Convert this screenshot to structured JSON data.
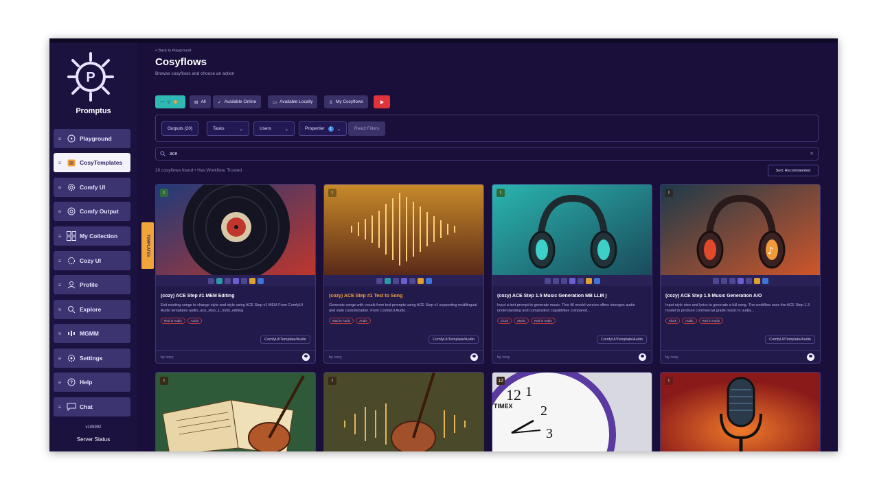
{
  "sidebar": {
    "brand": "Promptus",
    "items": [
      {
        "label": "Playground",
        "icon": "play-circle-icon"
      },
      {
        "label": "CosyTemplates",
        "icon": "template-icon"
      },
      {
        "label": "Comfy UI",
        "icon": "gear-icon"
      },
      {
        "label": "Comfy Output",
        "icon": "output-icon"
      },
      {
        "label": "My Collection",
        "icon": "grid-icon"
      },
      {
        "label": "Cozy UI",
        "icon": "cog-icon"
      },
      {
        "label": "Profile",
        "icon": "user-icon"
      },
      {
        "label": "Explore",
        "icon": "search-icon"
      },
      {
        "label": "MGMM",
        "icon": "mgmm-icon"
      },
      {
        "label": "Settings",
        "icon": "settings-icon"
      },
      {
        "label": "Help",
        "icon": "help-icon"
      },
      {
        "label": "Chat",
        "icon": "chat-icon"
      }
    ],
    "version": "v105992",
    "server_status": "Server Status",
    "side_tab": "TEMPLATES"
  },
  "header": {
    "back": "< Back to Playground",
    "title": "Cosyflows",
    "subtitle": "Browse cosyflows and choose an action"
  },
  "tabs": {
    "all": "All",
    "available_online": "Available Online",
    "available_locally": "Available Locally",
    "my_cosyflows": "My Cosyflows"
  },
  "filters": {
    "outputs": "Outputs (20)",
    "tasks": "Tasks",
    "users": "Users",
    "properties": "Propertier",
    "reset": "React Filters"
  },
  "search": {
    "value": "ace"
  },
  "results": {
    "summary": "20 cosyflows found • Has Workflow, Trusted",
    "sort": "Sort: Recommended"
  },
  "cards": [
    {
      "title": "(cozy) ACE Step #1 MEM Editing",
      "desc": "Exit existing songs to change style-and style using ACE Step v1 MEM From ComfyUI Audio templates audio_ace_step_1_m2in_editing",
      "tags": [
        "Red to Audio",
        "Audio"
      ],
      "path": "ComfyUI/Template/Audio",
      "author": "by cozy",
      "highlight": false
    },
    {
      "title": "(cozy) ACE Step #1 Test to Song",
      "desc": "Generate songs with vocals from text prompts using ACE Step v1 supporting multilingual and style customization. From ComfyUI Audio...",
      "tags": [
        "Mad to Audio",
        "Audio"
      ],
      "path": "ComfyUI/Template/Audio",
      "author": "by cozy",
      "highlight": true
    },
    {
      "title": "(cozy) ACE Step 1.5 Music Generation MB LLM )",
      "desc": "Input a text prompt to generate music. This 46 model version offers stranges audio understanding and composition capabilities compared...",
      "tags": [
        "Clock",
        "Music",
        "Red to Audio"
      ],
      "path": "ComfyUI/Template/Audio",
      "author": "by cozy",
      "highlight": false
    },
    {
      "title": "(cozy) ACE Step 1.5 Music Generation A/O",
      "desc": "Input style steo and lyrics to generate a full song. The workflow uses the ACE Step 1.3 model to produce commercial grade music in uudia...",
      "tags": [
        "Klock",
        "Audio",
        "Red to Audio"
      ],
      "path": "ComfyUI/Template/Audio",
      "author": "by cozy",
      "highlight": false
    }
  ],
  "clock_brand": "TIMEX",
  "colors": {
    "bg": "#1a0f3a",
    "accent_orange": "#f2a33d",
    "teal": "#2fb8b4",
    "youtube": "#e0343a"
  }
}
